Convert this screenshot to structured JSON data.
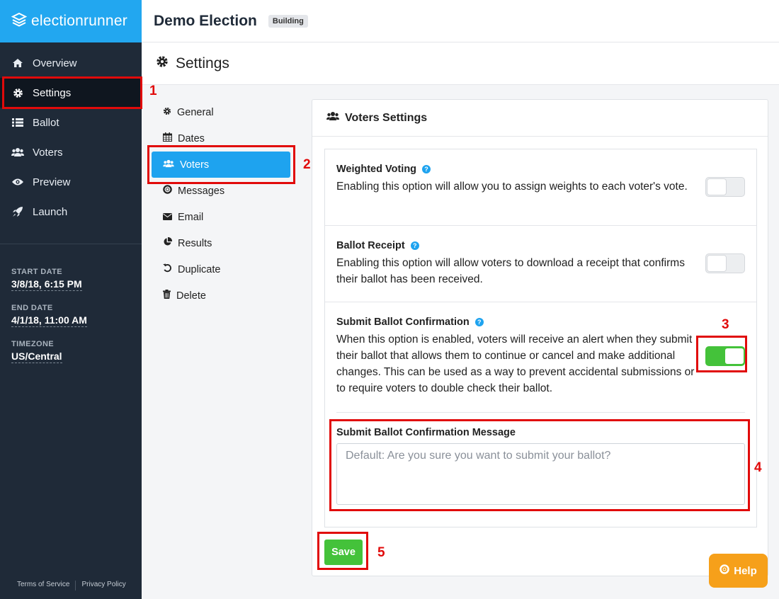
{
  "brand": {
    "name": "electionrunner"
  },
  "sidebar": {
    "items": [
      {
        "label": "Overview",
        "icon": "home-icon"
      },
      {
        "label": "Settings",
        "icon": "gear-icon"
      },
      {
        "label": "Ballot",
        "icon": "list-icon"
      },
      {
        "label": "Voters",
        "icon": "users-icon"
      },
      {
        "label": "Preview",
        "icon": "eye-icon"
      },
      {
        "label": "Launch",
        "icon": "rocket-icon"
      }
    ],
    "meta": {
      "start_label": "START DATE",
      "start_value": "3/8/18, 6:15 PM",
      "end_label": "END DATE",
      "end_value": "4/1/18, 11:00 AM",
      "tz_label": "TIMEZONE",
      "tz_value": "US/Central"
    },
    "footer": {
      "terms": "Terms of Service",
      "privacy": "Privacy Policy"
    }
  },
  "header": {
    "election_title": "Demo Election",
    "status": "Building"
  },
  "page": {
    "title": "Settings"
  },
  "subnav": {
    "items": [
      {
        "label": "General"
      },
      {
        "label": "Dates"
      },
      {
        "label": "Voters"
      },
      {
        "label": "Messages"
      },
      {
        "label": "Email"
      },
      {
        "label": "Results"
      },
      {
        "label": "Duplicate"
      },
      {
        "label": "Delete"
      }
    ]
  },
  "card": {
    "title": "Voters Settings",
    "settings": [
      {
        "title": "Weighted Voting",
        "desc": "Enabling this option will allow you to assign weights to each voter's vote.",
        "enabled": false
      },
      {
        "title": "Ballot Receipt",
        "desc": "Enabling this option will allow voters to download a receipt that confirms their ballot has been received.",
        "enabled": false
      },
      {
        "title": "Submit Ballot Confirmation",
        "desc": "When this option is enabled, voters will receive an alert when they submit their ballot that allows them to continue or cancel and make additional changes. This can be used as a way to prevent accidental submissions or to require voters to double check their ballot.",
        "enabled": true
      }
    ],
    "message_label": "Submit Ballot Confirmation Message",
    "message_placeholder": "Default: Are you sure you want to submit your ballot?",
    "message_value": "",
    "save_label": "Save"
  },
  "help": {
    "label": "Help"
  },
  "annotations": [
    "1",
    "2",
    "3",
    "4",
    "5"
  ],
  "colors": {
    "accent": "#1ea3ef",
    "sidebar": "#1f2a38",
    "success": "#44c23a",
    "annotation": "#e10a0a",
    "help": "#f6a01a"
  }
}
